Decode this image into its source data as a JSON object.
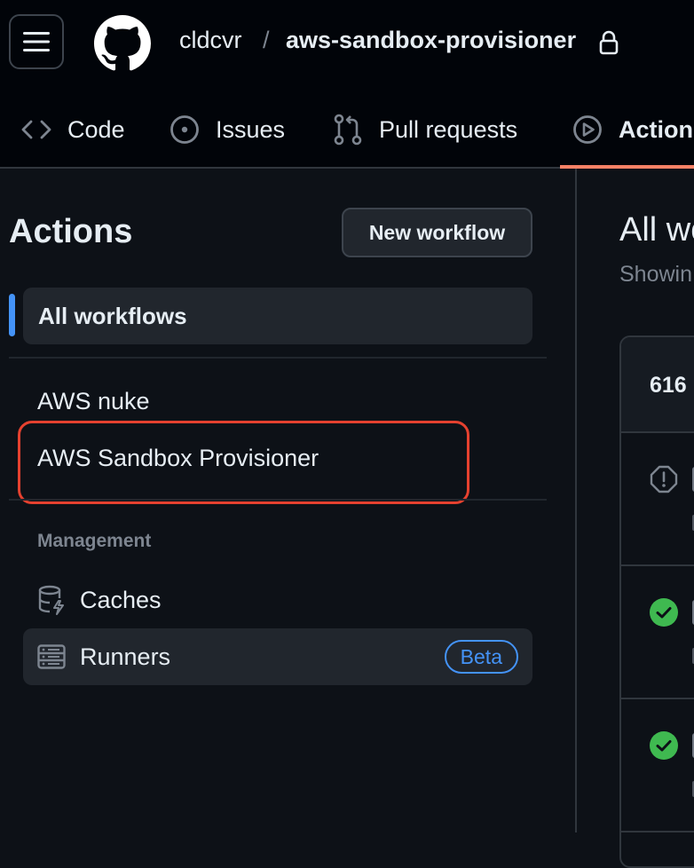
{
  "header": {
    "owner": "cldcvr",
    "separator": "/",
    "repo": "aws-sandbox-provisioner",
    "tabs": [
      {
        "label": "Code",
        "icon": "code-icon"
      },
      {
        "label": "Issues",
        "icon": "issue-opened-icon"
      },
      {
        "label": "Pull requests",
        "icon": "git-pull-request-icon"
      },
      {
        "label": "Actions",
        "icon": "play-icon",
        "selected": true
      }
    ]
  },
  "sidebar": {
    "title": "Actions",
    "new_workflow_label": "New workflow",
    "all_workflows_label": "All workflows",
    "workflows": [
      "AWS nuke",
      "AWS Sandbox Provisioner"
    ],
    "management_label": "Management",
    "management_items": [
      {
        "label": "Caches",
        "icon": "database-icon"
      },
      {
        "label": "Runners",
        "icon": "server-icon",
        "badge": "Beta"
      }
    ]
  },
  "main": {
    "title": "All wo",
    "subtitle": "Showin",
    "runs_count": "616",
    "runs": [
      {
        "status": "alert-icon"
      },
      {
        "status": "check-circle-icon"
      },
      {
        "status": "check-circle-icon"
      }
    ]
  },
  "colors": {
    "accent_blue": "#4493f8",
    "tab_underline": "#f78166",
    "highlight_red": "#e5412f",
    "success_green": "#3fb950"
  }
}
